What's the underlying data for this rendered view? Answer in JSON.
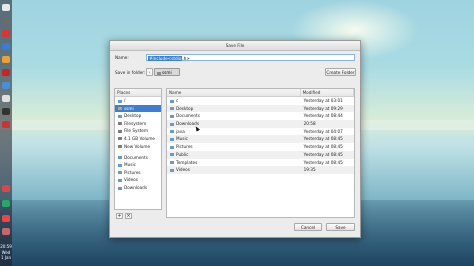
{
  "dialog": {
    "title": "Save File",
    "name_label": "Name:",
    "name_value_selected": "#include<stdio",
    "name_value_rest": ".h>",
    "save_in_label": "Save in folder:",
    "back_glyph": "‹",
    "current_folder": "ssmi",
    "create_folder_label": "Create Folder",
    "cancel_label": "Cancel",
    "save_label": "Save",
    "add_glyph": "+",
    "remove_glyph": "×"
  },
  "places": {
    "header": "Places",
    "items": [
      {
        "label": "/",
        "icon": "folder-icon"
      },
      {
        "label": "ssmi",
        "icon": "home-icon"
      },
      {
        "label": "Desktop",
        "icon": "folder-icon"
      },
      {
        "label": "Filesystem",
        "icon": "drive-icon"
      },
      {
        "label": "File System",
        "icon": "drive-icon"
      },
      {
        "label": "4.1 GB Volume",
        "icon": "drive-icon"
      },
      {
        "label": "New Volume",
        "icon": "drive-icon"
      },
      {
        "label": "Documents",
        "icon": "folder-icon"
      },
      {
        "label": "Music",
        "icon": "folder-icon"
      },
      {
        "label": "Pictures",
        "icon": "folder-icon"
      },
      {
        "label": "Videos",
        "icon": "folder-icon"
      },
      {
        "label": "Downloads",
        "icon": "folder-icon"
      }
    ]
  },
  "files": {
    "col_name": "Name",
    "col_modified": "Modified",
    "rows": [
      {
        "name": "c",
        "modified": "Yesterday at 03:01"
      },
      {
        "name": "Desktop",
        "modified": "Yesterday at 09:29"
      },
      {
        "name": "Documents",
        "modified": "Yesterday at 08:44"
      },
      {
        "name": "Downloads",
        "modified": "20:58"
      },
      {
        "name": "java",
        "modified": "Yesterday at 04:07"
      },
      {
        "name": "Music",
        "modified": "Yesterday at 08:45"
      },
      {
        "name": "Pictures",
        "modified": "Yesterday at 08:45"
      },
      {
        "name": "Public",
        "modified": "Yesterday at 08:45"
      },
      {
        "name": "Templates",
        "modified": "Yesterday at 08:45"
      },
      {
        "name": "Videos",
        "modified": "19:35"
      }
    ]
  },
  "dock": {
    "clock_time": "20:59",
    "clock_date": "Wed 1 Jan",
    "colors": [
      "#e8e8e8",
      "#6b6b6b",
      "#d33",
      "#3a7bd5",
      "#f0a030",
      "#c22",
      "#4a90d9",
      "#e0e0e0",
      "#333",
      "#c33",
      "#d44",
      "#2a6",
      "#e44",
      "#c66"
    ]
  }
}
